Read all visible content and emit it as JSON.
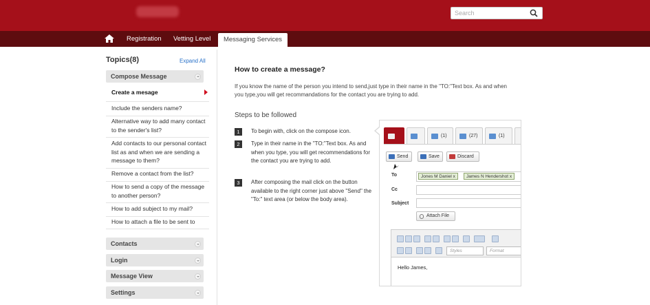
{
  "header": {
    "search_placeholder": "Search",
    "icons": {
      "search": "search-icon"
    }
  },
  "nav": {
    "home_icon": "home-icon",
    "items": [
      "Registration",
      "Vetting Level"
    ],
    "active_tab": "Messaging Services"
  },
  "sidebar": {
    "title": "Topics(8)",
    "expand_all": "Expand All",
    "compose_panel": "Compose Message",
    "topics": [
      "Create a mesage",
      "Include the senders name?",
      "Alternative way to add many contact to the sender's list?",
      "Add contacts to our personal contact list as and when we are sending a message to them?",
      "Remove a contact from the list?",
      "How to send a copy of the message to another person?",
      "How to add subject to my mail?",
      "How to attach a file to be sent to"
    ],
    "other_panels": [
      "Contacts",
      "Login",
      "Message View",
      "Settings"
    ]
  },
  "main": {
    "title": "How to create a message?",
    "intro": "If you know the name of the person you intend to send,just type in their name in the \"TO:\"Text box. As and when you type,you will get recommandations for the contact you are trying to add.",
    "steps_title": "Steps to be followed",
    "steps": [
      {
        "num": "1",
        "text": "To begin with, click on the compose icon."
      },
      {
        "num": "2",
        "text": "Type in their name in the \"TO:\"Text box. As and when you type, you will get recommendations for the contact you are trying to add."
      },
      {
        "num": "3",
        "text": "After composing the mail click on the button available to the right corner just above \"Send\" the \"To:\" text area (or below the body area)."
      }
    ]
  },
  "illustration": {
    "ribbon": [
      {
        "label": ""
      },
      {
        "label": ""
      },
      {
        "label": "(1)"
      },
      {
        "label": "(27)"
      },
      {
        "label": "(1)"
      }
    ],
    "actions": [
      "Send",
      "Save",
      "Discard"
    ],
    "fields": {
      "to": "To",
      "cc": "Cc",
      "subject": "Subject"
    },
    "to_chips": [
      "Jones M Daniel x",
      "James N Hendershot x"
    ],
    "attach": "Attach File",
    "styles_placeholder": "Styles",
    "format_placeholder": "Format",
    "body_text": "Hello James,"
  }
}
